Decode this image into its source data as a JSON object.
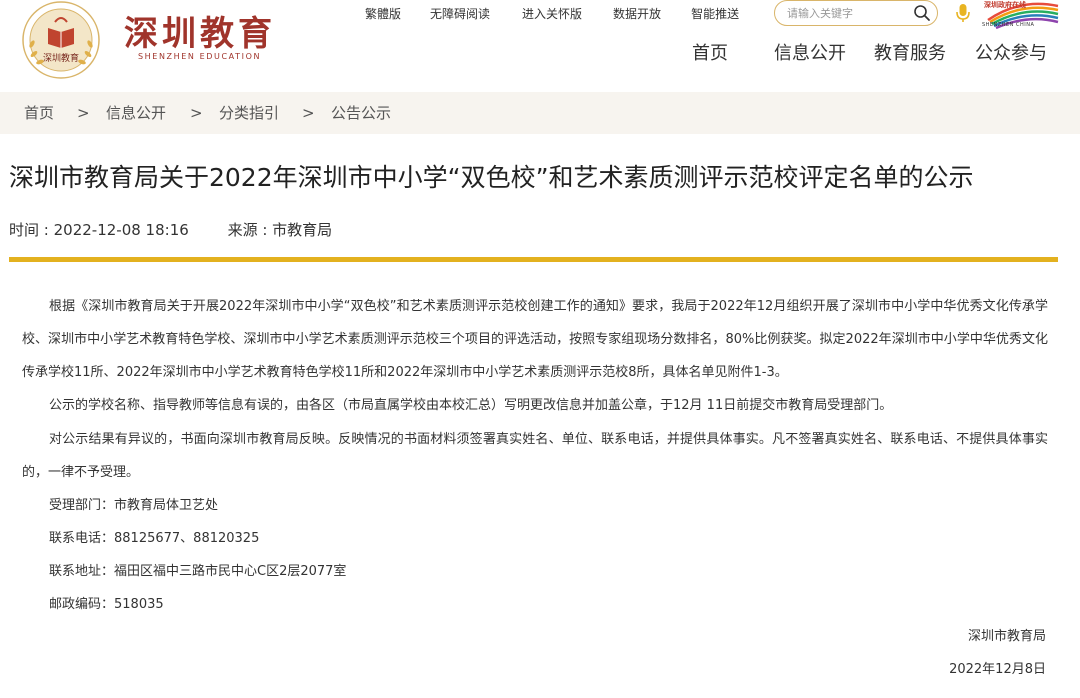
{
  "header": {
    "logo_cn": "深圳教育",
    "logo_en": "SHENZHEN EDUCATION",
    "emblem_text": "深圳教育",
    "brand_text": "深圳政府在线",
    "brand_en": "SHENZHEN CHINA",
    "top_links": [
      "繁體版",
      "无障碍阅读",
      "进入关怀版",
      "数据开放",
      "智能推送"
    ],
    "search_placeholder": "请输入关键字",
    "main_nav": [
      "首页",
      "信息公开",
      "教育服务",
      "公众参与"
    ]
  },
  "breadcrumb": {
    "items": [
      "首页",
      "信息公开",
      "分类指引",
      "公告公示"
    ],
    "separator": ">"
  },
  "article": {
    "title": "深圳市教育局关于2022年深圳市中小学“双色校”和艺术素质测评示范校评定名单的公示",
    "time_label": "时间 :",
    "time_value": "2022-12-08 18:16",
    "source_label": "来源 :",
    "source_value": "市教育局",
    "paragraphs": [
      "根据《深圳市教育局关于开展2022年深圳市中小学“双色校”和艺术素质测评示范校创建工作的通知》要求，我局于2022年12月组织开展了深圳市中小学中华优秀文化传承学校、深圳市中小学艺术教育特色学校、深圳市中小学艺术素质测评示范校三个项目的评选活动，按照专家组现场分数排名，80%比例获奖。拟定2022年深圳市中小学中华优秀文化传承学校11所、2022年深圳市中小学艺术教育特色学校11所和2022年深圳市中小学艺术素质测评示范校8所，具体名单见附件1-3。",
      "公示的学校名称、指导教师等信息有误的，由各区（市局直属学校由本校汇总）写明更改信息并加盖公章，于12月 11日前提交市教育局受理部门。",
      "对公示结果有异议的，书面向深圳市教育局反映。反映情况的书面材料须签署真实姓名、单位、联系电话，并提供具体事实。凡不签署真实姓名、联系电话、不提供具体事实的，一律不予受理。"
    ],
    "contacts": [
      "受理部门：市教育局体卫艺处",
      "联系电话：88125677、88120325",
      "联系地址：福田区福中三路市民中心C区2层2077室",
      "邮政编码：518035"
    ],
    "signer": "深圳市教育局",
    "sign_date": "2022年12月8日"
  },
  "colors": {
    "logo_red": "#a0342b",
    "gold_bar": "#e3b11f",
    "breadcrumb_bg": "#f7f4ef",
    "search_border": "#d9b56a"
  }
}
